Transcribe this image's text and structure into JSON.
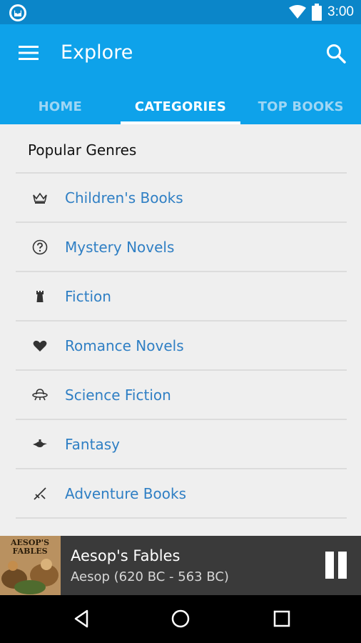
{
  "status_bar": {
    "time": "3:00",
    "icons": [
      "app-notification-icon",
      "wifi-icon",
      "battery-icon"
    ]
  },
  "app_bar": {
    "title": "Explore",
    "icons": [
      "menu-icon",
      "search-icon"
    ],
    "background": "#0ea2ea"
  },
  "tabs": [
    {
      "label": "HOME",
      "active": false
    },
    {
      "label": "CATEGORIES",
      "active": true
    },
    {
      "label": "TOP BOOKS",
      "active": false
    }
  ],
  "content": {
    "section_title": "Popular Genres",
    "genres": [
      {
        "label": "Children's Books",
        "icon": "crown-icon"
      },
      {
        "label": "Mystery Novels",
        "icon": "question-mark-icon"
      },
      {
        "label": "Fiction",
        "icon": "tower-icon"
      },
      {
        "label": "Romance Novels",
        "icon": "heart-icon"
      },
      {
        "label": "Science Fiction",
        "icon": "ufo-icon"
      },
      {
        "label": "Fantasy",
        "icon": "magic-lamp-icon"
      },
      {
        "label": "Adventure Books",
        "icon": "crossed-swords-icon"
      }
    ],
    "link_color": "#2f7fc4"
  },
  "player": {
    "cover_text": "AESOP'S FABLES",
    "title": "Aesop's Fables",
    "author": "Aesop (620 BC - 563 BC)",
    "state": "playing"
  },
  "nav_bar": {
    "buttons": [
      "back-icon",
      "home-icon",
      "recents-icon"
    ]
  }
}
